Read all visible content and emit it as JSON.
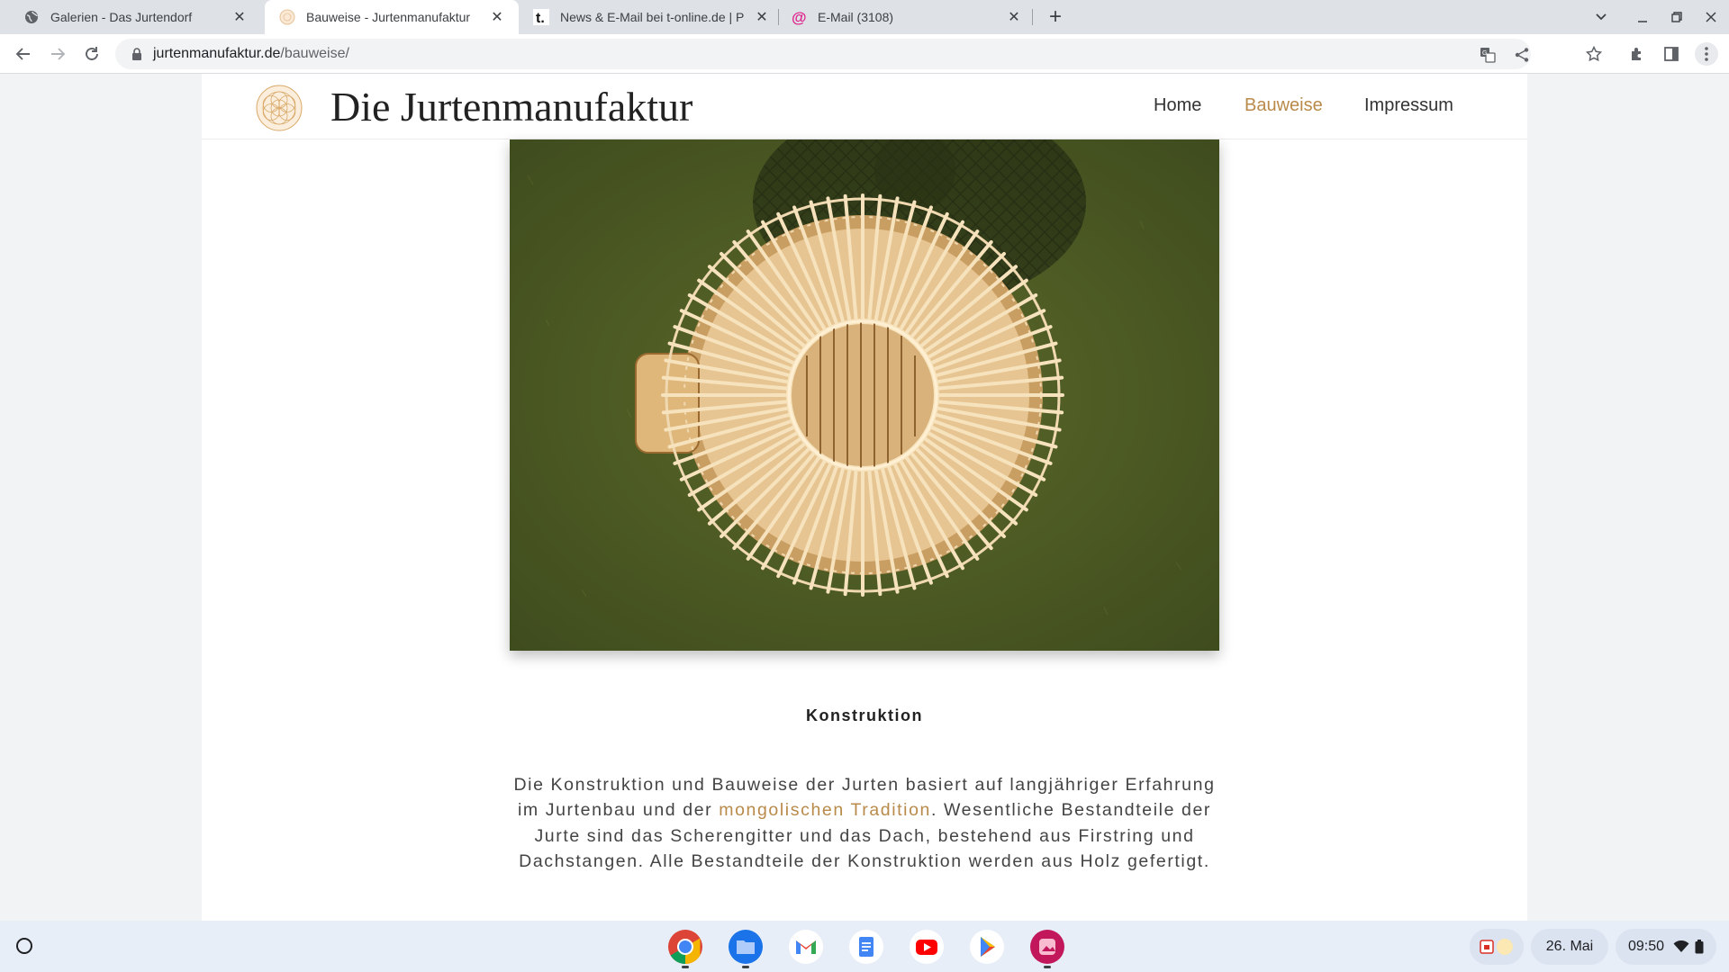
{
  "browser": {
    "tabs": [
      {
        "title": "Galerien - Das Jurtendorf",
        "favicon": "globe-icon",
        "active": false
      },
      {
        "title": "Bauweise - Jurtenmanufaktur",
        "favicon": "site-logo-icon",
        "active": true
      },
      {
        "title": "News & E-Mail bei t-online.de | P",
        "favicon": "t-online-icon",
        "active": false
      },
      {
        "title": "E-Mail (3108)",
        "favicon": "at-icon",
        "active": false
      }
    ],
    "url_host": "jurtenmanufaktur.de",
    "url_path": "/bauweise/"
  },
  "site": {
    "title": "Die Jurtenmanufaktur",
    "nav": [
      {
        "label": "Home",
        "active": false
      },
      {
        "label": "Bauweise",
        "active": true
      },
      {
        "label": "Impressum",
        "active": false
      }
    ],
    "accent_color": "#b98a4a"
  },
  "content": {
    "image_label": "",
    "section_title": "Konstruktion",
    "text_before_link": "Die Konstruktion und Bauweise der Jurten basiert auf langjähriger Erfahrung im Jurtenbau und der ",
    "link_text": "mongolischen Tradition",
    "text_after_link": ". Wesentliche Bestandteile der Jurte sind das Scherengitter und das Dach, bestehend aus Firstring und Dachstangen. Alle Bestandteile der Konstruktion werden aus Holz gefertigt."
  },
  "shelf": {
    "apps": [
      "chrome-icon",
      "files-icon",
      "gmail-icon",
      "docs-icon",
      "youtube-icon",
      "play-store-icon",
      "gallery-icon"
    ],
    "date": "26. Mai",
    "time": "09:50"
  }
}
